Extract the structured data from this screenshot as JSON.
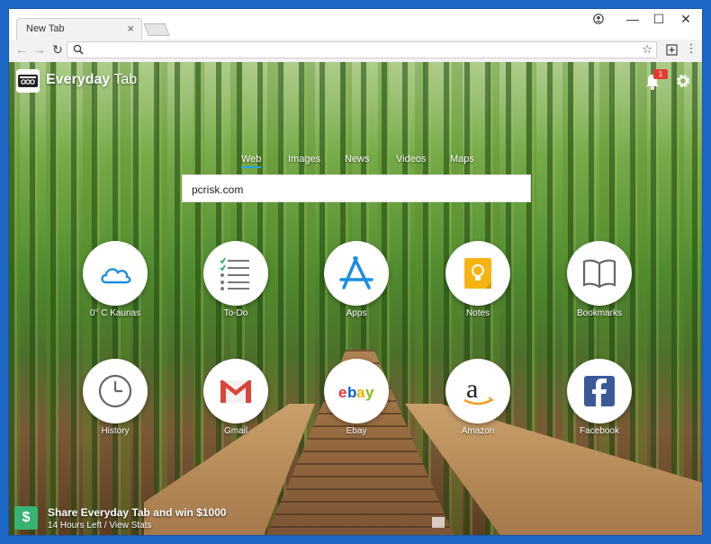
{
  "browser": {
    "tab_title": "New Tab",
    "tab_close": "×",
    "address_value": "",
    "window_controls": {
      "minimize": "—",
      "maximize": "☐",
      "close": "✕"
    }
  },
  "header": {
    "brand_bold": "Everyday",
    "brand_rest": " Tab",
    "notification_count": "1"
  },
  "search": {
    "tabs": [
      "Web",
      "Images",
      "News",
      "Videos",
      "Maps"
    ],
    "active_tab": "Web",
    "value": "pcrisk.com"
  },
  "tiles": [
    {
      "label": "0° C Kaunas",
      "icon": "cloud-icon"
    },
    {
      "label": "To-Do",
      "icon": "checklist-icon"
    },
    {
      "label": "Apps",
      "icon": "app-store-icon"
    },
    {
      "label": "Notes",
      "icon": "notes-icon"
    },
    {
      "label": "Bookmarks",
      "icon": "book-icon"
    },
    {
      "label": "History",
      "icon": "clock-icon"
    },
    {
      "label": "Gmail",
      "icon": "gmail-icon"
    },
    {
      "label": "Ebay",
      "icon": "ebay-icon"
    },
    {
      "label": "Amazon",
      "icon": "amazon-icon"
    },
    {
      "label": "Facebook",
      "icon": "facebook-icon"
    }
  ],
  "promo": {
    "icon_text": "$",
    "title": "Share Everyday Tab and win $1000",
    "subtitle": "14 Hours Left / View Stats"
  },
  "colors": {
    "window_frame": "#1f67c6",
    "active_tab_underline": "#2aa6e0",
    "badge": "#e53935",
    "promo": "#37b374"
  }
}
